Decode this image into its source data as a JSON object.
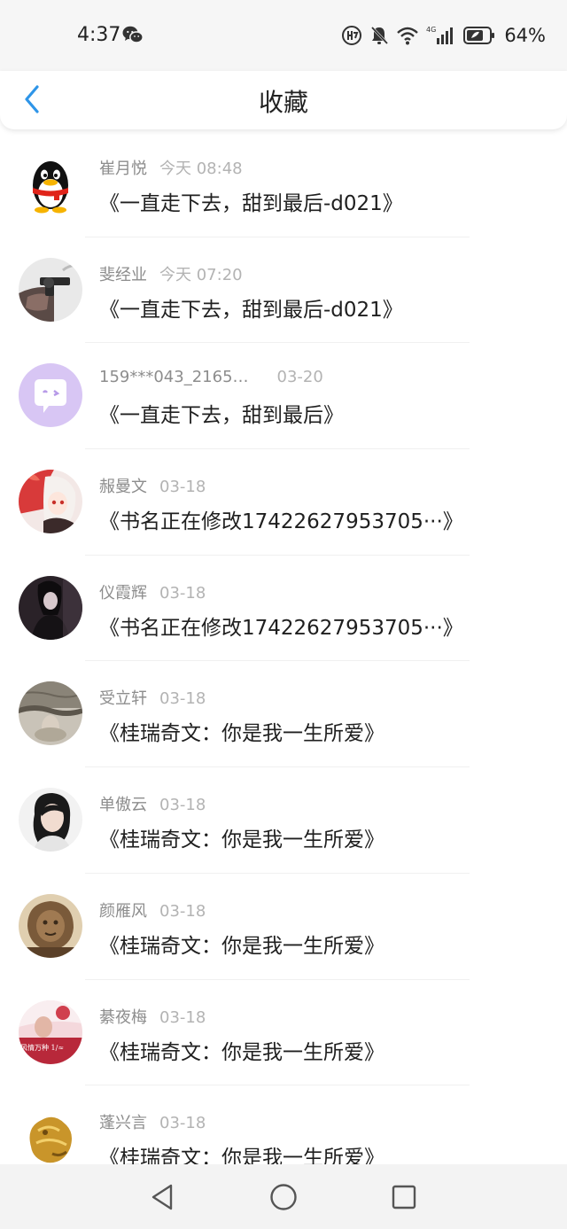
{
  "status_bar": {
    "time": "4:37",
    "battery_pct": "64%",
    "network_label": "4G"
  },
  "header": {
    "title": "收藏"
  },
  "items": [
    {
      "name": "崔月悦",
      "time": "今天 08:48",
      "title": "《一直走下去，甜到最后-d021》",
      "avatar": "qq-penguin"
    },
    {
      "name": "斐经业",
      "time": "今天 07:20",
      "title": "《一直走下去，甜到最后-d021》",
      "avatar": "hand-pistol"
    },
    {
      "name": "159***043_2165…",
      "time": "03-20",
      "title": "《一直走下去，甜到最后》",
      "avatar": "purple-chat"
    },
    {
      "name": "赧曼文",
      "time": "03-18",
      "title": "《书名正在修改17422627953705···》",
      "avatar": "anime-girl"
    },
    {
      "name": "仪霞辉",
      "time": "03-18",
      "title": "《书名正在修改17422627953705···》",
      "avatar": "dark-figure"
    },
    {
      "name": "受立轩",
      "time": "03-18",
      "title": "《桂瑞奇文：你是我一生所爱》",
      "avatar": "underwater"
    },
    {
      "name": "单傲云",
      "time": "03-18",
      "title": "《桂瑞奇文：你是我一生所爱》",
      "avatar": "girl-portrait"
    },
    {
      "name": "颜雁风",
      "time": "03-18",
      "title": "《桂瑞奇文：你是我一生所爱》",
      "avatar": "lion-statue"
    },
    {
      "name": "綦夜梅",
      "time": "03-18",
      "title": "《桂瑞奇文：你是我一生所爱》",
      "avatar": "pink-text",
      "avatar_text": "风情万种   1/≈"
    },
    {
      "name": "蓬兴言",
      "time": "03-18",
      "title": "《桂瑞奇文：你是我一生所爱》",
      "avatar": "gold-dragon"
    }
  ],
  "colors": {
    "accent": "#2e95e8",
    "title_text": "#1f1f1f",
    "meta_text": "#8d8d8d"
  },
  "icons": {
    "back": "chevron-left-icon",
    "nav_back": "triangle-back-icon",
    "nav_home": "circle-home-icon",
    "nav_recent": "square-recent-icon"
  }
}
